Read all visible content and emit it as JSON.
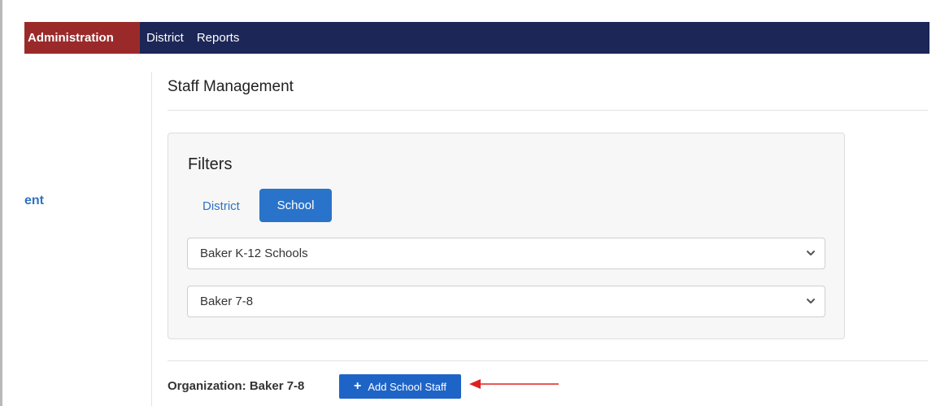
{
  "nav": {
    "items": [
      {
        "label": "Administration"
      },
      {
        "label": "District"
      },
      {
        "label": "Reports"
      }
    ]
  },
  "sidebar": {
    "partial_label": "ent"
  },
  "main": {
    "title": "Staff Management",
    "filters": {
      "title": "Filters",
      "toggle": {
        "district_label": "District",
        "school_label": "School"
      },
      "selects": [
        {
          "value": "Baker K-12 Schools"
        },
        {
          "value": "Baker 7-8"
        }
      ]
    },
    "organization_label": "Organization: Baker 7-8",
    "add_button_label": "Add School Staff"
  },
  "colors": {
    "nav_bg": "#1c2657",
    "nav_active": "#9a2a2a",
    "primary": "#2a73cb",
    "annotation_arrow": "#e02020"
  }
}
